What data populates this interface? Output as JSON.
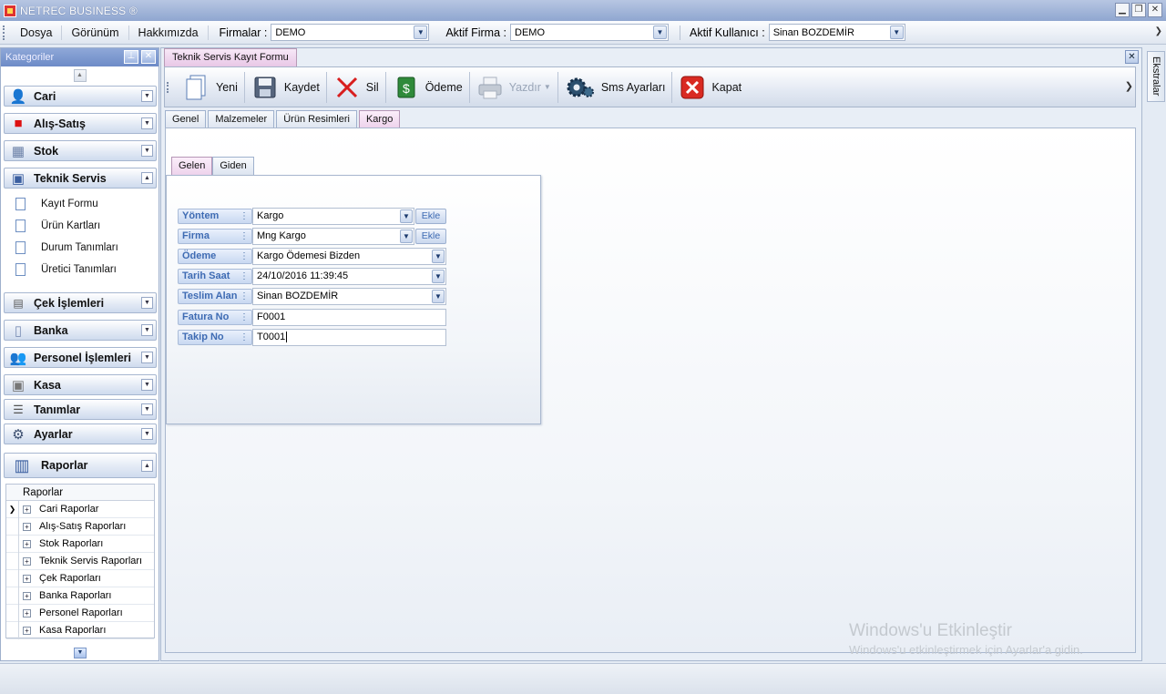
{
  "window": {
    "title": "NETREC BUSINESS ®"
  },
  "menubar": {
    "items": [
      "Dosya",
      "Görünüm",
      "Hakkımızda"
    ],
    "firmalar_label": "Firmalar :",
    "firmalar_value": "DEMO",
    "aktif_firma_label": "Aktif Firma :",
    "aktif_firma_value": "DEMO",
    "aktif_kullanici_label": "Aktif Kullanıcı :",
    "aktif_kullanici_value": "Sinan BOZDEMİR"
  },
  "sidebar": {
    "title": "Kategoriler",
    "groups": [
      {
        "label": "Cari",
        "icon": "user-icon"
      },
      {
        "label": "Alış-Satış",
        "icon": "shopping-bag-icon"
      },
      {
        "label": "Stok",
        "icon": "box-icon"
      },
      {
        "label": "Teknik Servis",
        "icon": "toolbox-icon"
      },
      {
        "label": "Çek İşlemleri",
        "icon": "cheque-icon"
      },
      {
        "label": "Banka",
        "icon": "bank-icon"
      },
      {
        "label": "Personel İşlemleri",
        "icon": "personnel-icon"
      },
      {
        "label": "Kasa",
        "icon": "safe-icon"
      },
      {
        "label": "Tanımlar",
        "icon": "list-icon"
      },
      {
        "label": "Ayarlar",
        "icon": "settings-icon"
      },
      {
        "label": "Raporlar",
        "icon": "report-chart-icon"
      }
    ],
    "teknik_servis_items": [
      "Kayıt Formu",
      "Ürün Kartları",
      "Durum Tanımları",
      "Üretici Tanımları"
    ],
    "reports": {
      "header": "Raporlar",
      "rows": [
        "Cari Raporlar",
        "Alış-Satış Raporları",
        "Stok Raporları",
        "Teknik Servis Raporları",
        "Çek Raporları",
        "Banka Raporları",
        "Personel Raporları",
        "Kasa Raporları"
      ]
    }
  },
  "document": {
    "tab_title": "Teknik Servis Kayıt Formu",
    "toolbar": {
      "yeni": "Yeni",
      "kaydet": "Kaydet",
      "sil": "Sil",
      "odeme": "Ödeme",
      "yazdir": "Yazdır",
      "sms": "Sms Ayarları",
      "kapat": "Kapat"
    },
    "tabs": [
      "Genel",
      "Malzemeler",
      "Ürün Resimleri",
      "Kargo"
    ],
    "active_tab": "Kargo",
    "subtabs": [
      "Gelen",
      "Giden"
    ],
    "active_subtab": "Gelen",
    "form": {
      "yontem_label": "Yöntem",
      "yontem_value": "Kargo",
      "firma_label": "Firma",
      "firma_value": "Mng Kargo",
      "ekle_label": "Ekle",
      "odeme_label": "Ödeme",
      "odeme_value": "Kargo Ödemesi Bizden",
      "tarih_label": "Tarih Saat",
      "tarih_value": "24/10/2016 11:39:45",
      "teslim_label": "Teslim Alan",
      "teslim_value": "Sinan BOZDEMİR",
      "fatura_label": "Fatura No",
      "fatura_value": "F0001",
      "takip_label": "Takip No",
      "takip_value": "T0001"
    }
  },
  "right_rail": {
    "tab_label": "Ekstralar"
  },
  "watermark": {
    "line1": "Windows'u Etkinleştir",
    "line2": "Windows'u etkinleştirmek için Ayarlar'a gidin."
  }
}
